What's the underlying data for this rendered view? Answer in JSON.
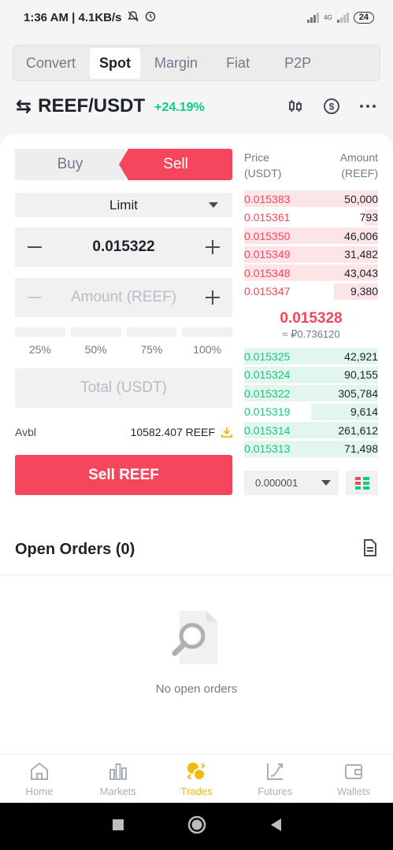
{
  "status_bar": {
    "time_speed": "1:36 AM | 4.1KB/s",
    "network": "4G",
    "battery": "24"
  },
  "tabs": [
    {
      "label": "Convert",
      "active": false
    },
    {
      "label": "Spot",
      "active": true
    },
    {
      "label": "Margin",
      "active": false
    },
    {
      "label": "Fiat",
      "active": false
    },
    {
      "label": "P2P",
      "active": false
    }
  ],
  "pair": {
    "symbol": "REEF/USDT",
    "change": "+24.19%"
  },
  "trade": {
    "buy_label": "Buy",
    "sell_label": "Sell",
    "order_type": "Limit",
    "price_value": "0.015322",
    "amount_placeholder": "Amount (REEF)",
    "percentages": [
      "25%",
      "50%",
      "75%",
      "100%"
    ],
    "total_placeholder": "Total (USDT)",
    "avbl_label": "Avbl",
    "avbl_value": "10582.407 REEF",
    "submit_label": "Sell REEF"
  },
  "order_book": {
    "price_header": "Price\n(USDT)",
    "amount_header": "Amount\n(REEF)",
    "price_header_l1": "Price",
    "price_header_l2": "(USDT)",
    "amount_header_l1": "Amount",
    "amount_header_l2": "(REEF)",
    "asks": [
      {
        "price": "0.015383",
        "amount": "50,000",
        "depth": 1.0
      },
      {
        "price": "0.015361",
        "amount": "793",
        "depth": 0.1
      },
      {
        "price": "0.015350",
        "amount": "46,006",
        "depth": 1.0
      },
      {
        "price": "0.015349",
        "amount": "31,482",
        "depth": 1.0
      },
      {
        "price": "0.015348",
        "amount": "43,043",
        "depth": 1.0
      },
      {
        "price": "0.015347",
        "amount": "9,380",
        "depth": 0.33
      }
    ],
    "last_price": "0.015328",
    "last_fiat": "≈ ₽0.736120",
    "bids": [
      {
        "price": "0.015325",
        "amount": "42,921",
        "depth": 1.0
      },
      {
        "price": "0.015324",
        "amount": "90,155",
        "depth": 1.0
      },
      {
        "price": "0.015322",
        "amount": "305,784",
        "depth": 1.0
      },
      {
        "price": "0.015319",
        "amount": "9,614",
        "depth": 0.5
      },
      {
        "price": "0.015314",
        "amount": "261,612",
        "depth": 1.0
      },
      {
        "price": "0.015313",
        "amount": "71,498",
        "depth": 1.0
      }
    ],
    "decimals": "0.000001"
  },
  "open_orders": {
    "title": "Open Orders (0)",
    "empty_text": "No open orders"
  },
  "bottom_nav": [
    {
      "label": "Home",
      "icon": "home-icon",
      "active": false
    },
    {
      "label": "Markets",
      "icon": "markets-icon",
      "active": false
    },
    {
      "label": "Trades",
      "icon": "trades-icon",
      "active": true
    },
    {
      "label": "Futures",
      "icon": "futures-icon",
      "active": false
    },
    {
      "label": "Wallets",
      "icon": "wallets-icon",
      "active": false
    }
  ],
  "colors": {
    "sell": "#f6465d",
    "buy": "#0ecb81",
    "accent": "#f0b90b"
  }
}
